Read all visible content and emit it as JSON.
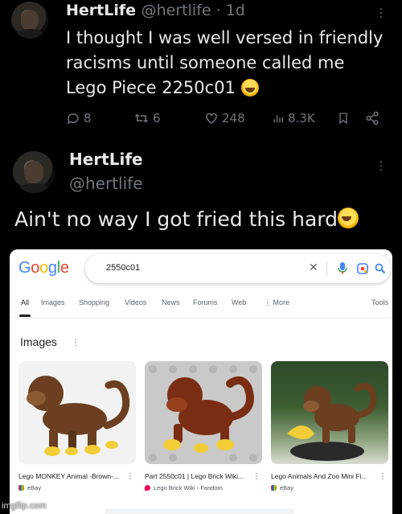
{
  "tweet1": {
    "display_name": "HertLife",
    "meta": "@hertlife · 1d",
    "text": "I thought I was well versed in friendly racisms until someone called me Lego Piece 2250c01",
    "emoji_icon": "rolling-on-floor-laughing-emoji",
    "actions": {
      "replies": "8",
      "retweets": "6",
      "likes": "248",
      "views": "8.3K"
    }
  },
  "tweet2": {
    "display_name": "HertLife",
    "handle": "@hertlife",
    "text": "Ain't no way I got fried this hard",
    "emoji_icon": "rolling-on-floor-laughing-emoji"
  },
  "google": {
    "logo_text": "Google",
    "query": "2550c01",
    "tabs": [
      "All",
      "Images",
      "Shopping",
      "Videos",
      "News",
      "Forums",
      "Web",
      "More",
      "Tools"
    ],
    "active_tab": "All",
    "section_title": "Images",
    "results": [
      {
        "title": "Lego MONKEY Animal -Brown-...",
        "source": "eBay"
      },
      {
        "title": "Part 2550c01 | Lego Brick Wiki...",
        "source": "Lego Brick Wiki - Fandom"
      },
      {
        "title": "Lego Animals And Zoo Mini Fi...",
        "source": "eBay"
      }
    ]
  },
  "watermark": "imgflip.com",
  "colors": {
    "background": "#000000",
    "text_primary": "#e7e9ea",
    "text_secondary": "#71767b",
    "google_blue": "#4285f4",
    "monkey_brown": "#6b3f1f",
    "monkey_brown_reddish": "#7a2d12",
    "lego_yellow": "#f2cd37"
  }
}
